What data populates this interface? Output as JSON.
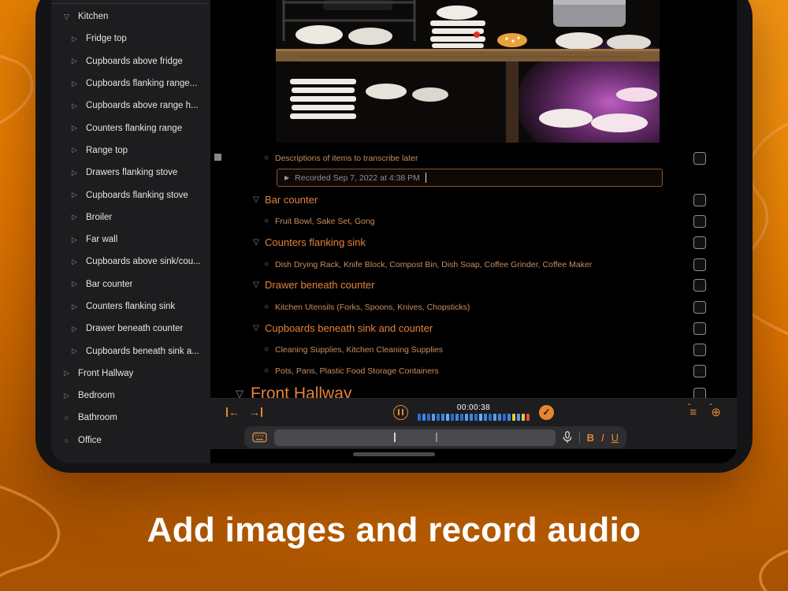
{
  "app": {
    "accent_color": "#E7862F",
    "sidebar_bg": "#1D1D1F",
    "content_bg": "#000000",
    "background_orange": "#EF8C08"
  },
  "caption": "Add images and record audio",
  "icons": {
    "disclosure_open": "▽",
    "disclosure_closed": "▷",
    "leaf_bullet": "○",
    "row_bullet": "○",
    "play": "▶",
    "check": "✓",
    "pause": "pause-bars",
    "outdent_arrow": "←",
    "indent_arrow": "→",
    "caret": "ˆ",
    "note_lines": "≡",
    "add": "⊕"
  },
  "sidebar": {
    "items": [
      {
        "label": "Kitchen",
        "disclosure": "open",
        "level": 0
      },
      {
        "label": "Fridge top",
        "disclosure": "closed",
        "level": 1
      },
      {
        "label": "Cupboards above fridge",
        "disclosure": "closed",
        "level": 1
      },
      {
        "label": "Cupboards flanking range...",
        "disclosure": "closed",
        "level": 1
      },
      {
        "label": "Cupboards above range h...",
        "disclosure": "closed",
        "level": 1
      },
      {
        "label": "Counters flanking range",
        "disclosure": "closed",
        "level": 1
      },
      {
        "label": "Range top",
        "disclosure": "closed",
        "level": 1
      },
      {
        "label": "Drawers flanking stove",
        "disclosure": "closed",
        "level": 1
      },
      {
        "label": "Cupboards flanking stove",
        "disclosure": "closed",
        "level": 1
      },
      {
        "label": "Broiler",
        "disclosure": "closed",
        "level": 1
      },
      {
        "label": "Far wall",
        "disclosure": "closed",
        "level": 1
      },
      {
        "label": "Cupboards above sink/cou...",
        "disclosure": "closed",
        "level": 1
      },
      {
        "label": "Bar counter",
        "disclosure": "closed",
        "level": 1
      },
      {
        "label": "Counters flanking sink",
        "disclosure": "closed",
        "level": 1
      },
      {
        "label": "Drawer beneath counter",
        "disclosure": "closed",
        "level": 1
      },
      {
        "label": "Cupboards beneath sink a...",
        "disclosure": "closed",
        "level": 1
      },
      {
        "label": "Front Hallway",
        "disclosure": "closed",
        "level": 0
      },
      {
        "label": "Bedroom",
        "disclosure": "closed",
        "level": 0
      },
      {
        "label": "Bathroom",
        "disclosure": "leaf",
        "level": 0
      },
      {
        "label": "Office",
        "disclosure": "leaf",
        "level": 0
      }
    ]
  },
  "outline": {
    "rows": [
      {
        "type": "item",
        "text": "Descriptions of items to transcribe later",
        "checked": false
      },
      {
        "type": "section",
        "text": "Bar counter",
        "checked": false
      },
      {
        "type": "item",
        "text": "Fruit Bowl, Sake Set, Gong",
        "checked": false
      },
      {
        "type": "section",
        "text": "Counters flanking sink",
        "checked": false
      },
      {
        "type": "item",
        "text": "Dish Drying Rack, Knife Block, Compost Bin, Dish Soap, Coffee Grinder, Coffee Maker",
        "checked": false
      },
      {
        "type": "section",
        "text": "Drawer beneath counter",
        "checked": false
      },
      {
        "type": "item",
        "text": "Kitchen Utensils (Forks, Spoons, Knives, Chopsticks)",
        "checked": false
      },
      {
        "type": "section",
        "text": "Cupboards beneath sink and counter",
        "checked": false
      },
      {
        "type": "item",
        "text": "Cleaning Supplies, Kitchen Cleaning Supplies",
        "checked": false
      },
      {
        "type": "item",
        "text": "Pots, Pans, Plastic Food Storage Containers",
        "checked": false
      },
      {
        "type": "section_large",
        "text": "Front Hallway",
        "checked": false
      }
    ],
    "audio_attachment": {
      "label": "Recorded Sep 7, 2022 at 4:38 PM"
    }
  },
  "recorder": {
    "time": "00:00:38",
    "meter_colors": [
      "#2d6bd0",
      "#3f87df",
      "#2d6bd0",
      "#54a0ea",
      "#2d6bd0",
      "#3f87df",
      "#63b4f2",
      "#2d6bd0",
      "#3f87df",
      "#2d6bd0",
      "#54a0ea",
      "#3f87df",
      "#2d6bd0",
      "#63b4f2",
      "#3f87df",
      "#2d6bd0",
      "#54a0ea",
      "#3f87df",
      "#2d6bd0",
      "#3f87df",
      "#e9c83f",
      "#54a0ea",
      "#e9c83f",
      "#e0523a"
    ]
  },
  "format_bar": {
    "bold": "B",
    "italic": "I",
    "underline": "U"
  }
}
